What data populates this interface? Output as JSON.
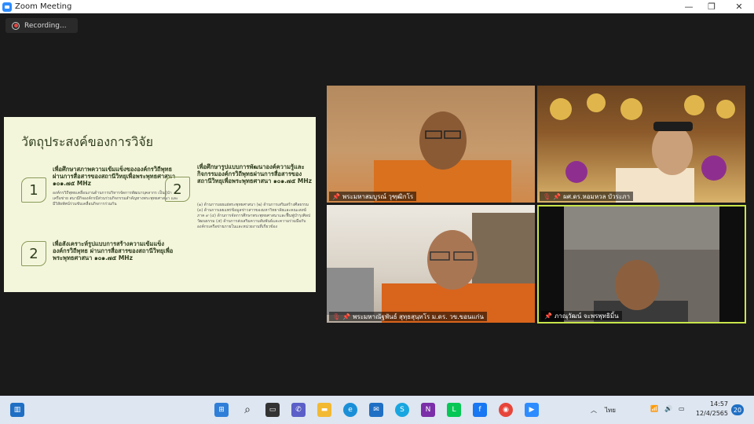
{
  "window": {
    "title": "Zoom Meeting",
    "controls": {
      "minimize": "—",
      "restore": "❐",
      "close": "✕"
    }
  },
  "recording": {
    "label": "Recording..."
  },
  "slide": {
    "title": "วัตถุประสงค์ของการวิจัย",
    "items": [
      {
        "number": "1",
        "heading": "เพื่อศึกษาสภาพความเข้มแข็งขององค์กรวิถีพุทธผ่านการสื่อสารของสถานีวิทยุเพื่อพระพุทธศาสนา ๑๐๑.๗๕ MHz",
        "body": "องค์กรวิถีพุทธเคลื่อนงานด้านการบริหารจัดการพัฒนาบุคลากร เป็นผู้นำเครือข่าย สนามีกิจองค์กรมีส่วนร่วมกิจกรรมสำคัญทางพระพุทธศาสนา และมีวิสัยทัศน์ร่วมขับเคลื่อนกิจการร่วมกัน"
      },
      {
        "number": "2",
        "heading": "เพื่อสังเคราะห์รูปแบบการสร้างความเข้มแข็งองค์กรวิถีพุทธ ผ่านการสื่อสารของสถานีวิทยุเพื่อพระพุทธศาสนา ๑๐๑.๗๕ MHz",
        "body": ""
      },
      {
        "number": "2",
        "heading": "เพื่อศึกษารูปแบบการพัฒนาองค์ความรู้และกิจกรรมองค์กรวิถีพุทธผ่านการสื่อสารของสถานีวิทยุเพื่อพระพุทธศาสนา ๑๐๑.๗๕ MHz",
        "body": "(๑) ด้านการเผยแผ่พระพุทธศาสนา (๒) ด้านการเสริมสร้างศีลธรรม (๓) ด้านการเผยแพร่ข้อมูลข่าวสารของมหาวิทยาลัยและคณะสงฆ์ภาค ๙ (๔) ด้านการจัดการศึกษาพระพุทธศาสนาและฟื้นฟูบำรุงศิลปวัฒนธรรม (๕) ด้านการส่งเสริมความสัมพันธ์และความร่วมมือกับองค์กรเครือข่ายภายในและหน่วยงานที่เกี่ยวข้อง"
      }
    ]
  },
  "participants": [
    {
      "name": "พระมหาสมบูรณ์ วุฑฺฒิกโร",
      "pinned": true,
      "muted": false,
      "active_speaker": false
    },
    {
      "name": "ผศ.ดร.หอมหวล บัวระภา",
      "pinned": true,
      "muted": true,
      "active_speaker": false
    },
    {
      "name": "พระมหาณัฐพันธ์ สุทฺธสุนฺทโร ม.ดร. วข.ขอนแก่น",
      "pinned": true,
      "muted": true,
      "active_speaker": false
    },
    {
      "name": "ภาณุวัฒน์ จะพรพุทธิมิ้น",
      "pinned": true,
      "muted": false,
      "active_speaker": true
    }
  ],
  "colors": {
    "active_speaker_border": "#c8e64a",
    "slide_bg": "#f4f6dc",
    "muted_icon": "#e24444"
  },
  "taskbar": {
    "apps": [
      {
        "icon": "windows-start-icon"
      },
      {
        "icon": "search-icon"
      },
      {
        "icon": "task-view-icon"
      },
      {
        "icon": "teams-chat-icon"
      },
      {
        "icon": "file-explorer-icon"
      },
      {
        "icon": "edge-icon"
      },
      {
        "icon": "mail-icon"
      },
      {
        "icon": "skype-icon"
      },
      {
        "icon": "onenote-icon"
      },
      {
        "icon": "line-icon"
      },
      {
        "icon": "facebook-icon"
      },
      {
        "icon": "chrome-icon"
      },
      {
        "icon": "zoom-icon"
      }
    ],
    "tray": {
      "language": "ไทย",
      "time": "14:57",
      "date": "12/4/2565",
      "notification_count": "20"
    }
  }
}
